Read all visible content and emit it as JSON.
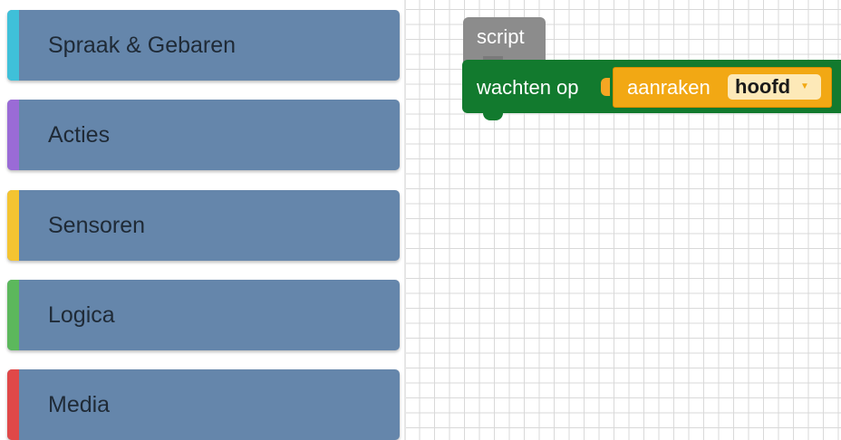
{
  "toolbox": {
    "categories": [
      {
        "label": "Spraak & Gebaren",
        "color": "#3fc0d9"
      },
      {
        "label": "Acties",
        "color": "#9a6bd6"
      },
      {
        "label": "Sensoren",
        "color": "#f4c431"
      },
      {
        "label": "Logica",
        "color": "#5cb85c"
      },
      {
        "label": "Media",
        "color": "#e04848"
      }
    ]
  },
  "workspace": {
    "hat_block": {
      "label": "script",
      "color": "#8c8c8c"
    },
    "main_block": {
      "label": "wachten op",
      "color": "#127a2e"
    },
    "value_block": {
      "label": "aanraken",
      "color": "#f2a814",
      "dropdown": {
        "selected": "hoofd",
        "arrow_icon": "triangle-down"
      }
    }
  }
}
